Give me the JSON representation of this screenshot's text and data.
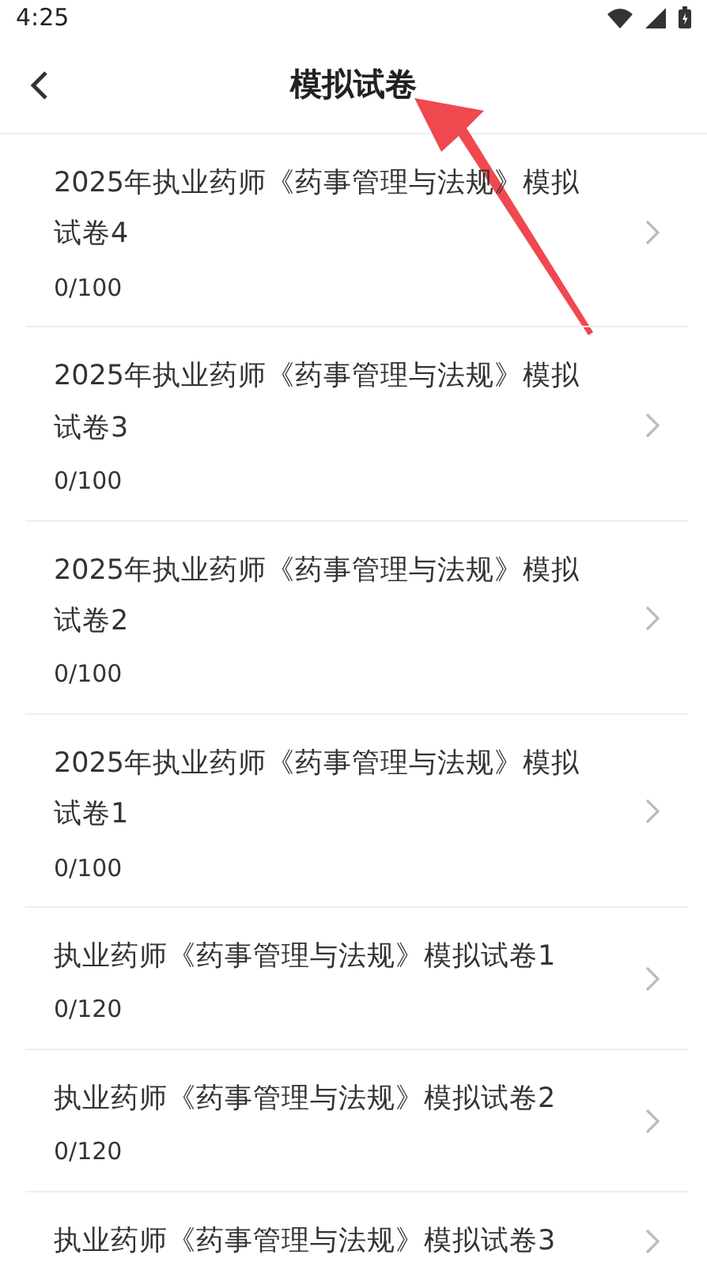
{
  "status_bar": {
    "time": "4:25"
  },
  "header": {
    "title": "模拟试卷"
  },
  "papers": [
    {
      "title": "2025年执业药师《药事管理与法规》模拟试卷4",
      "score": "0/100"
    },
    {
      "title": "2025年执业药师《药事管理与法规》模拟试卷3",
      "score": "0/100"
    },
    {
      "title": "2025年执业药师《药事管理与法规》模拟试卷2",
      "score": "0/100"
    },
    {
      "title": "2025年执业药师《药事管理与法规》模拟试卷1",
      "score": "0/100"
    },
    {
      "title": "执业药师《药事管理与法规》模拟试卷1",
      "score": "0/120"
    },
    {
      "title": "执业药师《药事管理与法规》模拟试卷2",
      "score": "0/120"
    },
    {
      "title": "执业药师《药事管理与法规》模拟试卷3"
    }
  ]
}
